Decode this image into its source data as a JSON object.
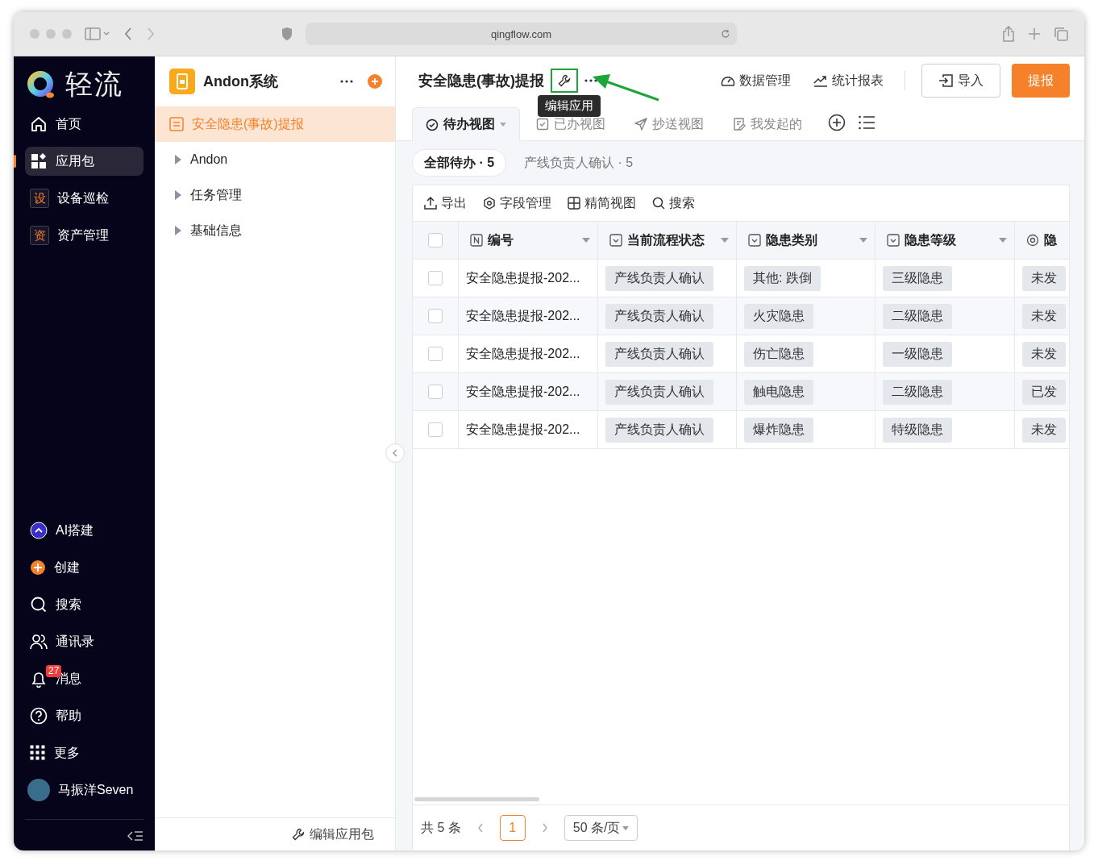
{
  "browser": {
    "url": "qingflow.com"
  },
  "sidebar": {
    "logo": "轻流",
    "nav": [
      {
        "label": "首页",
        "kind": "icon",
        "selected": false
      },
      {
        "label": "应用包",
        "kind": "icon",
        "selected": true
      },
      {
        "label": "设备巡检",
        "kind": "text-icon",
        "mark": "设",
        "selected": false
      },
      {
        "label": "资产管理",
        "kind": "text-icon",
        "mark": "资",
        "selected": false
      }
    ],
    "bottom": [
      {
        "label": "AI搭建"
      },
      {
        "label": "创建"
      },
      {
        "label": "搜索"
      },
      {
        "label": "通讯录"
      },
      {
        "label": "消息",
        "badge": "27"
      },
      {
        "label": "帮助"
      },
      {
        "label": "更多"
      }
    ],
    "user": "马振洋Seven"
  },
  "app_panel": {
    "title": "Andon系统",
    "items": [
      {
        "label": "安全隐患(事故)提报",
        "kind": "form",
        "selected": true
      },
      {
        "label": "Andon",
        "kind": "folder",
        "selected": false
      },
      {
        "label": "任务管理",
        "kind": "folder",
        "selected": false
      },
      {
        "label": "基础信息",
        "kind": "folder",
        "selected": false
      }
    ],
    "footer": "编辑应用包"
  },
  "header": {
    "title": "安全隐患(事故)提报",
    "tooltip": "编辑应用",
    "actions": [
      "数据管理",
      "统计报表"
    ],
    "import": "导入",
    "submit": "提报"
  },
  "tabs": [
    {
      "label": "待办视图",
      "selected": true
    },
    {
      "label": "已办视图",
      "selected": false
    },
    {
      "label": "抄送视图",
      "selected": false
    },
    {
      "label": "我发起的",
      "selected": false
    }
  ],
  "filters": [
    {
      "label": "全部待办 · 5",
      "selected": true
    },
    {
      "label": "产线负责人确认 · 5",
      "selected": false
    }
  ],
  "toolbar": [
    "导出",
    "字段管理",
    "精简视图",
    "搜索"
  ],
  "table": {
    "all_checked": false,
    "columns": [
      "编号",
      "当前流程状态",
      "隐患类别",
      "隐患等级",
      "隐"
    ],
    "rows": [
      {
        "checked": false,
        "cells": [
          "安全隐患提报-202...",
          "产线负责人确认",
          "其他: 跌倒",
          "三级隐患",
          "未发"
        ]
      },
      {
        "checked": false,
        "cells": [
          "安全隐患提报-202...",
          "产线负责人确认",
          "火灾隐患",
          "二级隐患",
          "未发"
        ]
      },
      {
        "checked": false,
        "cells": [
          "安全隐患提报-202...",
          "产线负责人确认",
          "伤亡隐患",
          "一级隐患",
          "未发"
        ]
      },
      {
        "checked": false,
        "cells": [
          "安全隐患提报-202...",
          "产线负责人确认",
          "触电隐患",
          "二级隐患",
          "已发"
        ]
      },
      {
        "checked": false,
        "cells": [
          "安全隐患提报-202...",
          "产线负责人确认",
          "爆炸隐患",
          "特级隐患",
          "未发"
        ]
      }
    ]
  },
  "pagination": {
    "total": "共 5 条",
    "page": "1",
    "page_size": "50 条/页"
  }
}
